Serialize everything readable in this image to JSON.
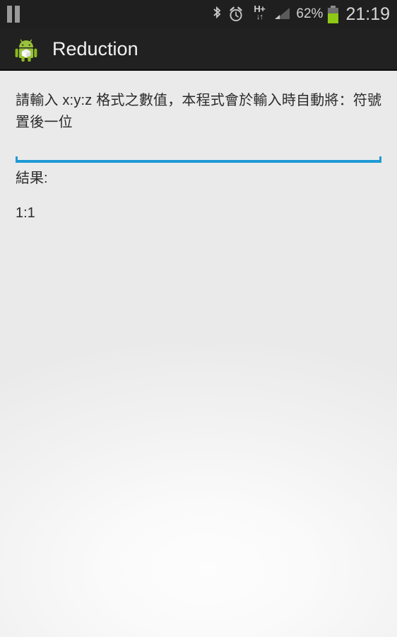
{
  "status_bar": {
    "left_icons": [
      {
        "name": "pause-icon",
        "label": "media playback paused"
      }
    ],
    "right_icons": [
      {
        "name": "bluetooth-icon",
        "label": "Bluetooth"
      },
      {
        "name": "alarm-clock-icon",
        "label": "Alarm set"
      },
      {
        "name": "hsdpa-plus-icon",
        "label": "H+",
        "arrows": "↓↑"
      },
      {
        "name": "signal-bars-icon",
        "label": "Mobile signal"
      }
    ],
    "battery_percent": "62%",
    "battery_level": 62,
    "clock": "21:19"
  },
  "action_bar": {
    "app_icon_name": "android-robot-icon",
    "title": "Reduction"
  },
  "content": {
    "hint_text": "請輸入 x:y:z 格式之數值，本程式會於輸入時自動將：符號置後一位",
    "input": {
      "value": "",
      "placeholder": ""
    },
    "result_label": "結果:",
    "result_value": "1:1"
  },
  "colors": {
    "status_bar_bg": "#1f1f1f",
    "action_bar_bg": "#212121",
    "accent_blue": "#1e9ad4",
    "battery_green": "#8ec916",
    "android_green": "#a4c639",
    "text_primary": "#2b2b2b",
    "content_bg": "#f2f2f2"
  }
}
